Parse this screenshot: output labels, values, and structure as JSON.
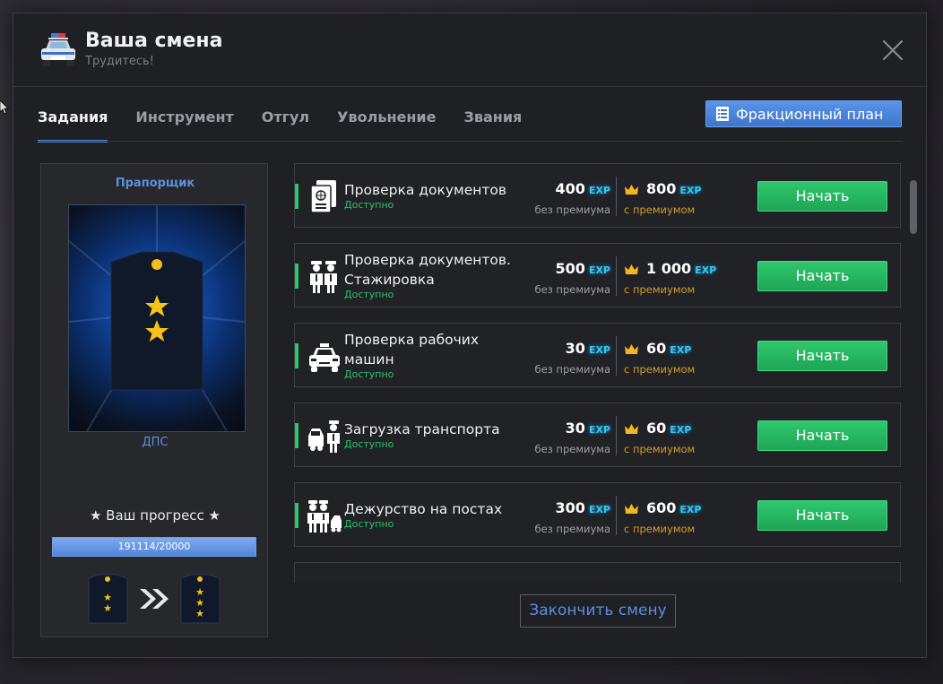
{
  "header": {
    "title": "Ваша смена",
    "subtitle": "Трудитесь!"
  },
  "tabs": [
    {
      "label": "Задания",
      "active": true
    },
    {
      "label": "Инструмент",
      "active": false
    },
    {
      "label": "Отгул",
      "active": false
    },
    {
      "label": "Увольнение",
      "active": false
    },
    {
      "label": "Звания",
      "active": false
    }
  ],
  "faction_plan_label": "Фракционный план",
  "rank": {
    "name": "Прапорщик",
    "unit": "ДПС",
    "progress_title": "★ Ваш прогресс ★",
    "progress_text": "191114/20000",
    "progress_fraction": 1.0,
    "current_stars": 2,
    "next_stars": 3
  },
  "exp_word": "EXP",
  "label_no_premium": "без премиума",
  "label_premium": "с премиумом",
  "start_label": "Начать",
  "tasks": [
    {
      "name": "Проверка документов",
      "status": "Доступно",
      "exp": "400",
      "exp_premium": "800",
      "icon": "passport-icon"
    },
    {
      "name": "Проверка документов. Стажировка",
      "status": "Доступно",
      "exp": "500",
      "exp_premium": "1 000",
      "icon": "officers-icon"
    },
    {
      "name": "Проверка рабочих машин",
      "status": "Доступно",
      "exp": "30",
      "exp_premium": "60",
      "icon": "police-car-icon"
    },
    {
      "name": "Загрузка транспорта",
      "status": "Доступно",
      "exp": "30",
      "exp_premium": "60",
      "icon": "tow-truck-icon"
    },
    {
      "name": "Дежурство на постах",
      "status": "Доступно",
      "exp": "300",
      "exp_premium": "600",
      "icon": "post-duty-icon"
    }
  ],
  "finish_label": "Закончить смену",
  "colors": {
    "accent_blue": "#4b86d8",
    "green": "#2cc36a",
    "premium_gold": "#d69c2c",
    "exp_cyan": "#33c8f0"
  }
}
